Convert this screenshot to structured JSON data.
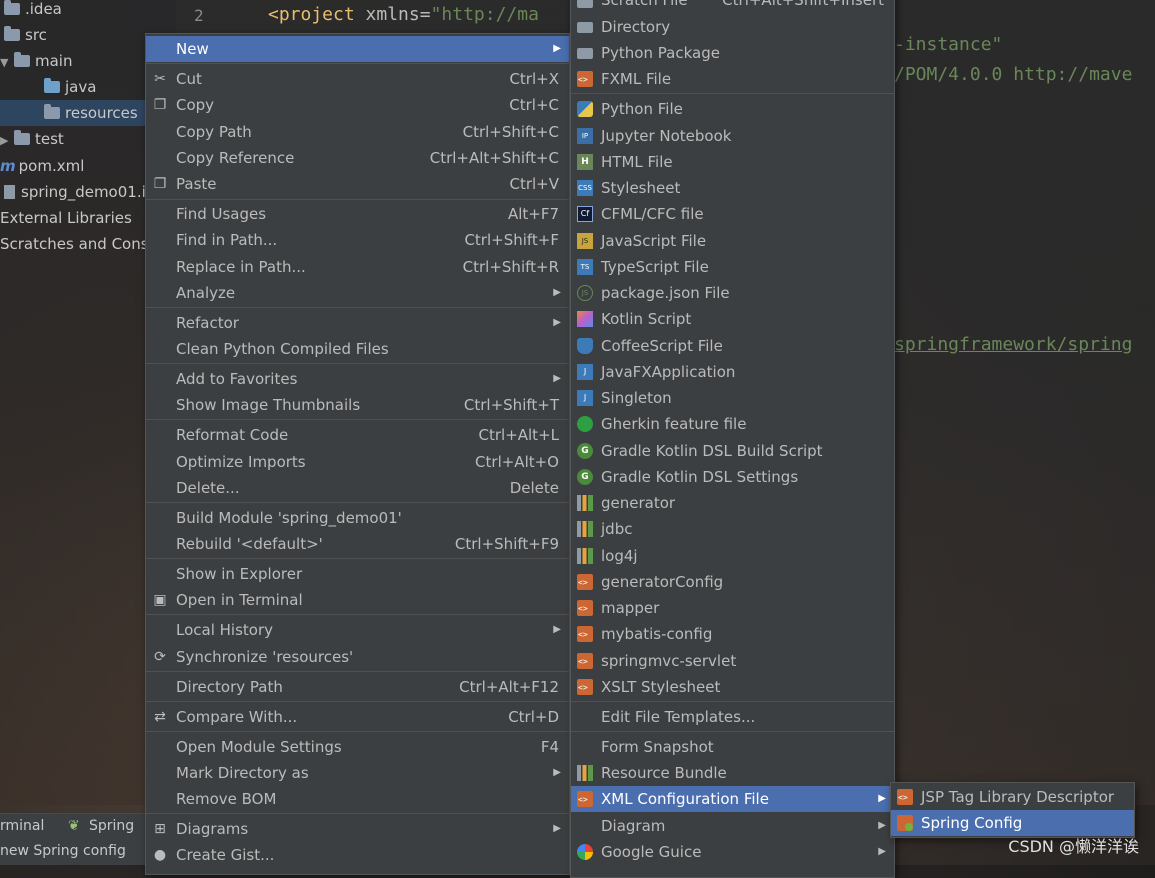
{
  "project_tree": {
    "items": [
      {
        "label": ".idea",
        "type": "folder"
      },
      {
        "label": "src",
        "type": "folder"
      },
      {
        "label": "main",
        "type": "folder"
      },
      {
        "label": "java",
        "type": "folder"
      },
      {
        "label": "resources",
        "type": "folder"
      },
      {
        "label": "test",
        "type": "folder"
      },
      {
        "label": "pom.xml",
        "type": "maven"
      },
      {
        "label": "spring_demo01.i",
        "type": "file"
      },
      {
        "label": "External Libraries",
        "type": "library"
      },
      {
        "label": "Scratches and Conso",
        "type": "scratch"
      }
    ]
  },
  "editor": {
    "line_number": "2",
    "line2": {
      "tag": "<project",
      "attr": " xmlns=",
      "str": "\"http://ma"
    },
    "frag1": "-instance\"",
    "frag2": "/POM/4.0.0 http://mave",
    "frag3": "springframework/spring"
  },
  "bottom": {
    "terminal_tab": "rminal",
    "spring_tab": "Spring",
    "status": "new Spring config"
  },
  "context_menu": {
    "items": [
      {
        "label": "New",
        "shortcut": "",
        "submenu": true,
        "highlight": true
      },
      {
        "label": "Cut",
        "shortcut": "Ctrl+X",
        "icon": "cut-icon"
      },
      {
        "label": "Copy",
        "shortcut": "Ctrl+C",
        "icon": "copy-icon"
      },
      {
        "label": "Copy Path",
        "shortcut": "Ctrl+Shift+C"
      },
      {
        "label": "Copy Reference",
        "shortcut": "Ctrl+Alt+Shift+C"
      },
      {
        "label": "Paste",
        "shortcut": "Ctrl+V",
        "icon": "paste-icon"
      },
      {
        "label": "Find Usages",
        "shortcut": "Alt+F7"
      },
      {
        "label": "Find in Path...",
        "shortcut": "Ctrl+Shift+F"
      },
      {
        "label": "Replace in Path...",
        "shortcut": "Ctrl+Shift+R"
      },
      {
        "label": "Analyze",
        "shortcut": "",
        "submenu": true
      },
      {
        "label": "Refactor",
        "shortcut": "",
        "submenu": true
      },
      {
        "label": "Clean Python Compiled Files",
        "shortcut": ""
      },
      {
        "label": "Add to Favorites",
        "shortcut": "",
        "submenu": true
      },
      {
        "label": "Show Image Thumbnails",
        "shortcut": "Ctrl+Shift+T"
      },
      {
        "label": "Reformat Code",
        "shortcut": "Ctrl+Alt+L"
      },
      {
        "label": "Optimize Imports",
        "shortcut": "Ctrl+Alt+O"
      },
      {
        "label": "Delete...",
        "shortcut": "Delete"
      },
      {
        "label": "Build Module 'spring_demo01'",
        "shortcut": ""
      },
      {
        "label": "Rebuild '<default>'",
        "shortcut": "Ctrl+Shift+F9"
      },
      {
        "label": "Show in Explorer",
        "shortcut": ""
      },
      {
        "label": "Open in Terminal",
        "shortcut": "",
        "icon": "terminal-icon"
      },
      {
        "label": "Local History",
        "shortcut": "",
        "submenu": true
      },
      {
        "label": "Synchronize 'resources'",
        "shortcut": "",
        "icon": "sync-icon"
      },
      {
        "label": "Directory Path",
        "shortcut": "Ctrl+Alt+F12"
      },
      {
        "label": "Compare With...",
        "shortcut": "Ctrl+D",
        "icon": "compare-icon"
      },
      {
        "label": "Open Module Settings",
        "shortcut": "F4"
      },
      {
        "label": "Mark Directory as",
        "shortcut": "",
        "submenu": true
      },
      {
        "label": "Remove BOM",
        "shortcut": ""
      },
      {
        "label": "Diagrams",
        "shortcut": "",
        "submenu": true,
        "icon": "diagram-icon"
      },
      {
        "label": "Create Gist...",
        "shortcut": "",
        "icon": "github-icon"
      }
    ]
  },
  "new_submenu": {
    "items": [
      {
        "label": "Scratch File",
        "shortcut": "Ctrl+Alt+Shift+Insert",
        "icon": "scratch-icon"
      },
      {
        "label": "Directory",
        "icon": "folder-icon"
      },
      {
        "label": "Python Package",
        "icon": "folder-icon"
      },
      {
        "label": "FXML File",
        "icon": "xml-icon"
      },
      {
        "label": "Python File",
        "icon": "python-icon"
      },
      {
        "label": "Jupyter Notebook",
        "icon": "jupyter-icon"
      },
      {
        "label": "HTML File",
        "icon": "html-icon"
      },
      {
        "label": "Stylesheet",
        "icon": "css-icon"
      },
      {
        "label": "CFML/CFC file",
        "icon": "cfml-icon"
      },
      {
        "label": "JavaScript File",
        "icon": "js-icon"
      },
      {
        "label": "TypeScript File",
        "icon": "ts-icon"
      },
      {
        "label": "package.json File",
        "icon": "nodejs-icon"
      },
      {
        "label": "Kotlin Script",
        "icon": "kotlin-icon"
      },
      {
        "label": "CoffeeScript File",
        "icon": "coffee-icon"
      },
      {
        "label": "JavaFXApplication",
        "icon": "javafx-icon"
      },
      {
        "label": "Singleton",
        "icon": "javafx-icon"
      },
      {
        "label": "Gherkin feature file",
        "icon": "gherkin-icon"
      },
      {
        "label": "Gradle Kotlin DSL Build Script",
        "icon": "gradle-icon"
      },
      {
        "label": "Gradle Kotlin DSL Settings",
        "icon": "gradle-icon"
      },
      {
        "label": "generator",
        "icon": "properties-icon"
      },
      {
        "label": "jdbc",
        "icon": "properties-icon"
      },
      {
        "label": "log4j",
        "icon": "properties-icon"
      },
      {
        "label": "generatorConfig",
        "icon": "xml-icon"
      },
      {
        "label": "mapper",
        "icon": "xml-icon"
      },
      {
        "label": "mybatis-config",
        "icon": "xml-icon"
      },
      {
        "label": "springmvc-servlet",
        "icon": "xml-icon"
      },
      {
        "label": "XSLT Stylesheet",
        "icon": "xml-icon"
      },
      {
        "label": "Edit File Templates..."
      },
      {
        "label": "Form Snapshot"
      },
      {
        "label": "Resource Bundle",
        "icon": "properties-icon"
      },
      {
        "label": "XML Configuration File",
        "icon": "xml-icon",
        "submenu": true,
        "highlight": true
      },
      {
        "label": "Diagram",
        "submenu": true
      },
      {
        "label": "Google Guice",
        "icon": "google-icon",
        "submenu": true
      }
    ]
  },
  "xml_submenu": {
    "items": [
      {
        "label": "JSP Tag Library Descriptor",
        "icon": "xml-icon"
      },
      {
        "label": "Spring Config",
        "icon": "spring-icon",
        "highlight": true
      }
    ]
  },
  "watermark": "CSDN @懒洋洋诶",
  "colors": {
    "menu_bg": "#3c3f41",
    "highlight": "#4b6eaf",
    "text": "#bbbbbb",
    "xml_tag": "#e8bf6a",
    "xml_string": "#6a8759"
  }
}
